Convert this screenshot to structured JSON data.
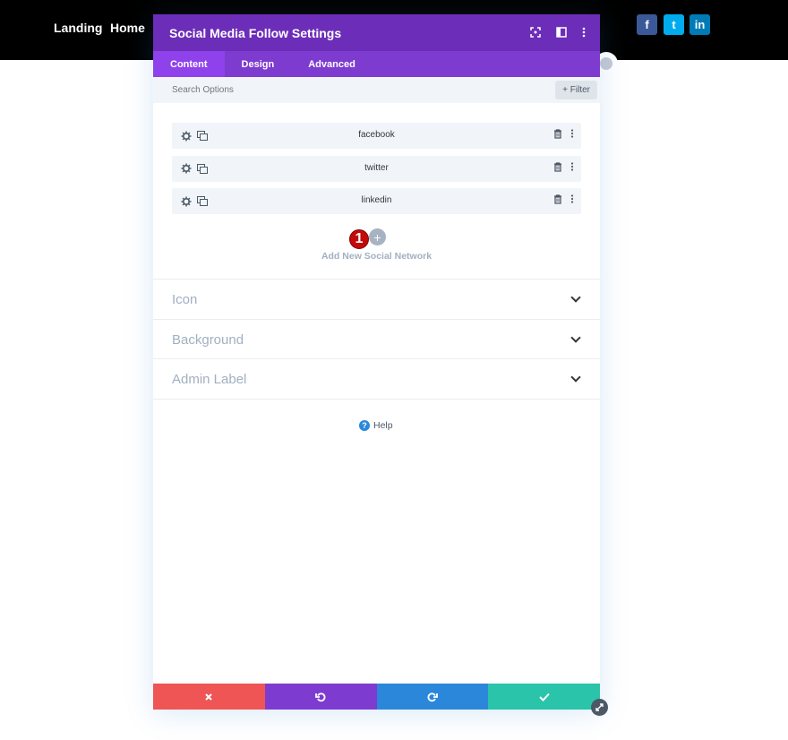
{
  "site": {
    "nav": [
      "Landing",
      "Home"
    ],
    "social": [
      {
        "icon": "f",
        "name": "facebook",
        "color": "#3b5998"
      },
      {
        "icon": "t",
        "name": "twitter",
        "color": "#00aced"
      },
      {
        "icon": "in",
        "name": "linkedin",
        "color": "#007bb6"
      }
    ]
  },
  "modal": {
    "title": "Social Media Follow Settings",
    "tabs": [
      {
        "label": "Content",
        "active": true
      },
      {
        "label": "Design",
        "active": false
      },
      {
        "label": "Advanced",
        "active": false
      }
    ],
    "search": {
      "placeholder": "Search Options"
    },
    "filter_label": "+ Filter",
    "networks": [
      {
        "label": "facebook"
      },
      {
        "label": "twitter"
      },
      {
        "label": "linkedin"
      }
    ],
    "add_badge": "1",
    "add_label": "Add New Social Network",
    "sections": [
      {
        "label": "Icon"
      },
      {
        "label": "Background"
      },
      {
        "label": "Admin Label"
      }
    ],
    "help_label": "Help"
  },
  "colors": {
    "header_purple": "#6c2eb9",
    "tab_purple": "#7e3bd0",
    "cancel_red": "#ef5555",
    "redo_blue": "#2b87da",
    "save_green": "#29c4a9"
  }
}
